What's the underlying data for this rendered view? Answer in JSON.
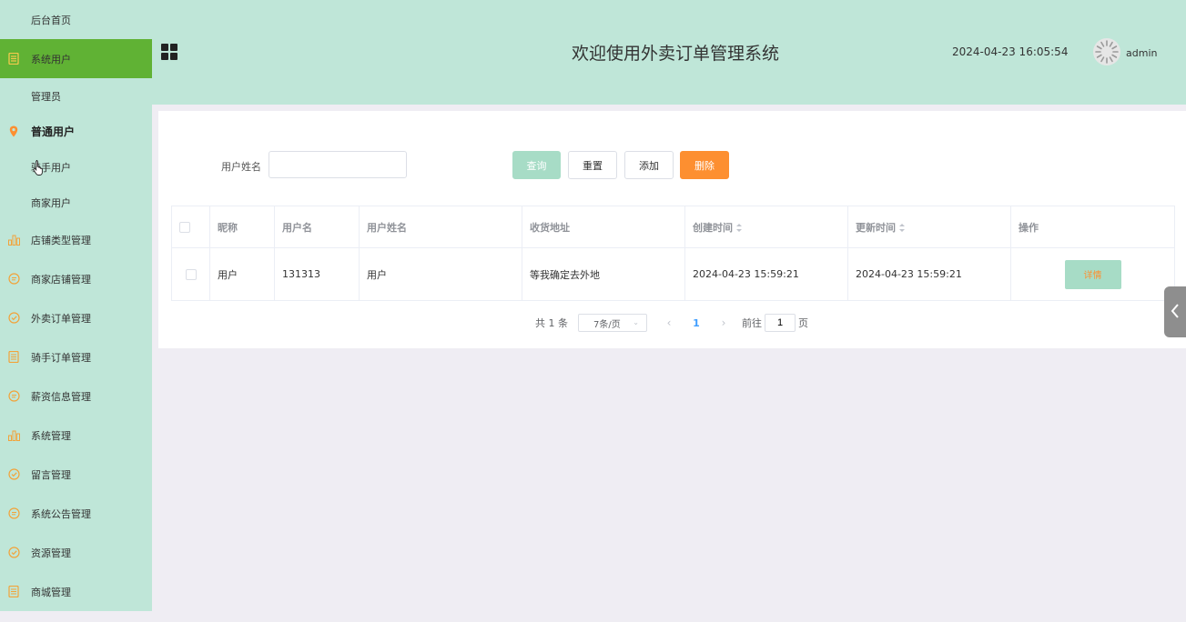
{
  "sidebar": {
    "items": [
      {
        "label": "后台首页",
        "icon": "none"
      },
      {
        "label": "系统用户",
        "icon": "document-icon",
        "active": true
      },
      {
        "label": "管理员",
        "icon": "none"
      },
      {
        "label": "普通用户",
        "icon": "location-pin-icon"
      },
      {
        "label": "骑手用户",
        "icon": "none"
      },
      {
        "label": "商家用户",
        "icon": "none"
      },
      {
        "label": "店铺类型管理",
        "icon": "bar-chart-icon"
      },
      {
        "label": "商家店铺管理",
        "icon": "chat-bubble-icon"
      },
      {
        "label": "外卖订单管理",
        "icon": "check-circle-icon"
      },
      {
        "label": "骑手订单管理",
        "icon": "document-icon"
      },
      {
        "label": "薪资信息管理",
        "icon": "chat-bubble-icon"
      },
      {
        "label": "系统管理",
        "icon": "bar-chart-icon"
      },
      {
        "label": "留言管理",
        "icon": "check-circle-icon"
      },
      {
        "label": "系统公告管理",
        "icon": "chat-bubble-icon"
      },
      {
        "label": "资源管理",
        "icon": "check-circle-icon"
      },
      {
        "label": "商城管理",
        "icon": "document-icon"
      }
    ]
  },
  "header": {
    "title": "欢迎使用外卖订单管理系统",
    "datetime": "2024-04-23 16:05:54",
    "username": "admin",
    "menu_icon": "grid-icon"
  },
  "search": {
    "label": "用户姓名",
    "value": "",
    "placeholder": ""
  },
  "toolbar": {
    "query": "查询",
    "reset": "重置",
    "add": "添加",
    "delete": "删除"
  },
  "table": {
    "headers": [
      "",
      "昵称",
      "用户名",
      "用户姓名",
      "收货地址",
      "创建时间",
      "更新时间",
      "操作"
    ],
    "rows": [
      {
        "nickname": "用户",
        "username": "131313",
        "realname": "用户",
        "address": "等我确定去外地",
        "created": "2024-04-23 15:59:21",
        "updated": "2024-04-23 15:59:21",
        "action": "详情"
      }
    ]
  },
  "pagination": {
    "total": "共 1 条",
    "page_size": "7条/页",
    "current_page": "1",
    "jump_label": "前往",
    "jump_value": "1",
    "page_suffix": "页"
  },
  "colors": {
    "sidebar_bg": "#bfe6d8",
    "active_bg": "#60b234",
    "accent_orange": "#fd8f30",
    "query_btn": "#a7dcc6"
  }
}
